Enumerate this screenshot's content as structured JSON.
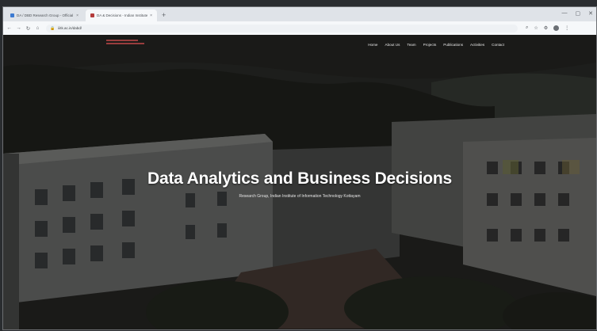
{
  "browser": {
    "tabs": [
      {
        "title": "DA / DBD Research Group - Official Site",
        "close": "×",
        "active": false
      },
      {
        "title": "DA & Decisions - Indian Institute...",
        "close": "×",
        "active": true
      }
    ],
    "new_tab": "+",
    "window_controls": [
      "—",
      "▢",
      "✕"
    ],
    "toolbar": {
      "back": "←",
      "forward": "→",
      "reload": "↻",
      "home": "⌂",
      "lock": "🔒",
      "url": "iiitk.ac.in/dabd/"
    },
    "toolbar_icons": [
      "⌕",
      "☆",
      "⚙",
      "⋮"
    ]
  },
  "site": {
    "nav": [
      "Home",
      "About Us",
      "Team",
      "Projects",
      "Publications",
      "Activities",
      "Contact"
    ],
    "hero": {
      "title": "Data Analytics and Business Decisions",
      "subtitle": "Research Group, Indian Institute of Information Technology Kottayam"
    }
  },
  "colors": {
    "accent_logo": "#b04444",
    "hero_text": "#ffffff"
  }
}
